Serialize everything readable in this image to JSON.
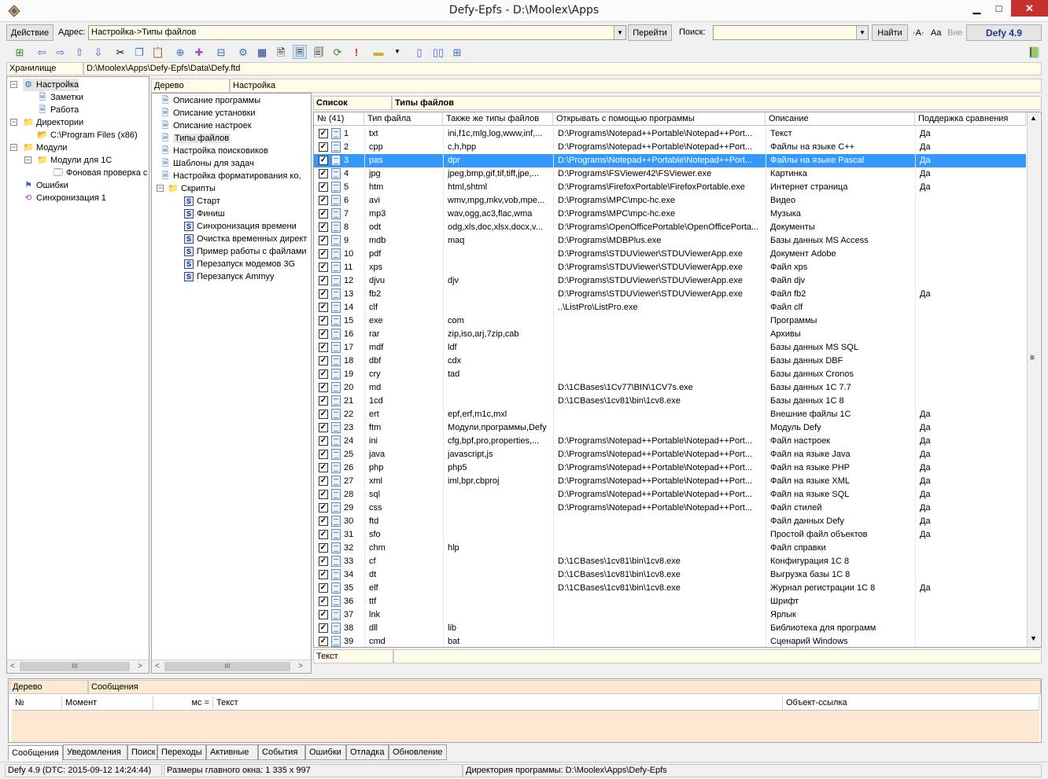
{
  "window": {
    "title": "Defy-Epfs - D:\\Moolex\\Apps",
    "min_label": "▁",
    "max_label": "□",
    "close_label": "✕"
  },
  "addressbar": {
    "action_label": "Действие",
    "address_label": "Адрес:",
    "address_value": "Настройка->Типы файлов",
    "go_label": "Перейти",
    "search_label": "Поиск:",
    "search_value": "",
    "find_label": "Найти",
    "case_label": "·A·",
    "word_label": "Aa",
    "outside_label": "Вне",
    "version_label": "Defy 4.9"
  },
  "storage": {
    "label": "Хранилище",
    "path": "D:\\Moolex\\Apps\\Defy-Epfs\\Data\\Defy.ftd"
  },
  "left_tree": {
    "items": [
      {
        "label": "Настройка",
        "icon": "settings-icon"
      },
      {
        "label": "Заметки",
        "icon": "page-icon"
      },
      {
        "label": "Работа",
        "icon": "page-icon"
      },
      {
        "label": "Директории",
        "icon": "folder-icon"
      },
      {
        "label": "C:\\Program Files (x86)",
        "icon": "folder-red-icon"
      },
      {
        "label": "Модули",
        "icon": "folder-icon"
      },
      {
        "label": "Модули для 1С",
        "icon": "folder-icon"
      },
      {
        "label": "Фоновая проверка с",
        "icon": "module-icon"
      },
      {
        "label": "Ошибки",
        "icon": "error-icon"
      },
      {
        "label": "Синхронизация 1",
        "icon": "sync-icon"
      }
    ]
  },
  "middle": {
    "header_left": "Дерево",
    "header_right": "Настройка",
    "items": [
      {
        "label": "Описание программы",
        "icon": "page-icon"
      },
      {
        "label": "Описание установки",
        "icon": "page-icon"
      },
      {
        "label": "Описание настроек",
        "icon": "page-icon"
      },
      {
        "label": "Типы файлов",
        "icon": "page-icon"
      },
      {
        "label": "Настройка поисковиков",
        "icon": "page-icon"
      },
      {
        "label": "Шаблоны для задач",
        "icon": "page-icon"
      },
      {
        "label": "Настройка форматирования ко,",
        "icon": "page-icon"
      },
      {
        "label": "Скрипты",
        "icon": "folder-icon"
      },
      {
        "label": "Старт",
        "icon": "script-icon"
      },
      {
        "label": "Финиш",
        "icon": "script-icon"
      },
      {
        "label": "Синхронизация времени",
        "icon": "script-icon"
      },
      {
        "label": "Очистка временных директ",
        "icon": "script-icon"
      },
      {
        "label": "Пример работы с файлами",
        "icon": "script-icon"
      },
      {
        "label": "Перезапуск модемов 3G",
        "icon": "script-icon"
      },
      {
        "label": "Перезапуск Ammyy",
        "icon": "script-icon"
      }
    ]
  },
  "list": {
    "header_left": "Список",
    "header_right": "Типы файлов",
    "columns": [
      "№ (41)",
      "Тип файла",
      "Также же типы файлов",
      "Открывать с помощью программы",
      "Описание",
      "Поддержка сравнения"
    ],
    "rows": [
      [
        "1",
        "txt",
        "ini,f1c,mlg,log,www,inf,...",
        "D:\\Programs\\Notepad++Portable\\Notepad++Port...",
        "Текст",
        "Да"
      ],
      [
        "2",
        "cpp",
        "c,h,hpp",
        "D:\\Programs\\Notepad++Portable\\Notepad++Port...",
        "Файлы на языке C++",
        "Да"
      ],
      [
        "3",
        "pas",
        "dpr",
        "D:\\Programs\\Notepad++Portable\\Notepad++Port...",
        "Файлы на языке Pascal",
        "Да"
      ],
      [
        "4",
        "jpg",
        "jpeg,bmp,gif,tif,tiff,jpe,...",
        "D:\\Programs\\FSViewer42\\FSViewer.exe",
        "Картинка",
        "Да"
      ],
      [
        "5",
        "htm",
        "html,shtml",
        "D:\\Programs\\FirefoxPortable\\FirefoxPortable.exe",
        "Интернет страница",
        "Да"
      ],
      [
        "6",
        "avi",
        "wmv,mpg,mkv,vob,mpe...",
        "D:\\Programs\\MPC\\mpc-hc.exe",
        "Видео",
        ""
      ],
      [
        "7",
        "mp3",
        "wav,ogg,ac3,flac,wma",
        "D:\\Programs\\MPC\\mpc-hc.exe",
        "Музыка",
        ""
      ],
      [
        "8",
        "odt",
        "odg,xls,doc,xlsx,docx,v...",
        "D:\\Programs\\OpenOfficePortable\\OpenOfficePorta...",
        "Документы",
        ""
      ],
      [
        "9",
        "mdb",
        "maq",
        "D:\\Programs\\MDBPlus.exe",
        "Базы данных MS Access",
        ""
      ],
      [
        "10",
        "pdf",
        "",
        "D:\\Programs\\STDUViewer\\STDUViewerApp.exe",
        "Документ Adobe",
        ""
      ],
      [
        "11",
        "xps",
        "",
        "D:\\Programs\\STDUViewer\\STDUViewerApp.exe",
        "Файл xps",
        ""
      ],
      [
        "12",
        "djvu",
        "djv",
        "D:\\Programs\\STDUViewer\\STDUViewerApp.exe",
        "Файл djv",
        ""
      ],
      [
        "13",
        "fb2",
        "",
        "D:\\Programs\\STDUViewer\\STDUViewerApp.exe",
        "Файл fb2",
        "Да"
      ],
      [
        "14",
        "clf",
        "",
        "..\\ListPro\\ListPro.exe",
        "Файл clf",
        ""
      ],
      [
        "15",
        "exe",
        "com",
        "",
        "Программы",
        ""
      ],
      [
        "16",
        "rar",
        "zip,iso,arj,7zip,cab",
        "",
        "Архивы",
        ""
      ],
      [
        "17",
        "mdf",
        "ldf",
        "",
        "Базы данных MS SQL",
        ""
      ],
      [
        "18",
        "dbf",
        "cdx",
        "",
        "Базы данных DBF",
        ""
      ],
      [
        "19",
        "cry",
        "tad",
        "",
        "Базы данных Cronos",
        ""
      ],
      [
        "20",
        "md",
        "",
        "D:\\1CBases\\1Cv77\\BIN\\1CV7s.exe",
        "Базы данных 1С 7.7",
        ""
      ],
      [
        "21",
        "1cd",
        "",
        "D:\\1CBases\\1cv81\\bin\\1cv8.exe",
        "Базы данных 1С 8",
        ""
      ],
      [
        "22",
        "ert",
        "epf,erf,m1c,mxl",
        "",
        "Внешние файлы 1С",
        "Да"
      ],
      [
        "23",
        "ftm",
        "Модули,программы,Defy",
        "",
        "Модуль Defy",
        "Да"
      ],
      [
        "24",
        "ini",
        "cfg,bpf,pro,properties,...",
        "D:\\Programs\\Notepad++Portable\\Notepad++Port...",
        "Файл настроек",
        "Да"
      ],
      [
        "25",
        "java",
        "javascript,js",
        "D:\\Programs\\Notepad++Portable\\Notepad++Port...",
        "Файл на языке Java",
        "Да"
      ],
      [
        "26",
        "php",
        "php5",
        "D:\\Programs\\Notepad++Portable\\Notepad++Port...",
        "Файл на языке PHP",
        "Да"
      ],
      [
        "27",
        "xml",
        "iml,bpr,cbproj",
        "D:\\Programs\\Notepad++Portable\\Notepad++Port...",
        "Файл на языке XML",
        "Да"
      ],
      [
        "28",
        "sql",
        "",
        "D:\\Programs\\Notepad++Portable\\Notepad++Port...",
        "Файл на языке SQL",
        "Да"
      ],
      [
        "29",
        "css",
        "",
        "D:\\Programs\\Notepad++Portable\\Notepad++Port...",
        "Файл стилей",
        "Да"
      ],
      [
        "30",
        "ftd",
        "",
        "",
        "Файл данных Defy",
        "Да"
      ],
      [
        "31",
        "sfo",
        "",
        "",
        "Простой файл объектов",
        "Да"
      ],
      [
        "32",
        "chm",
        "hlp",
        "",
        "Файл справки",
        ""
      ],
      [
        "33",
        "cf",
        "",
        "D:\\1CBases\\1cv81\\bin\\1cv8.exe",
        "Конфигурация 1С 8",
        ""
      ],
      [
        "34",
        "dt",
        "",
        "D:\\1CBases\\1cv81\\bin\\1cv8.exe",
        "Выгрузка базы 1С 8",
        ""
      ],
      [
        "35",
        "elf",
        "",
        "D:\\1CBases\\1cv81\\bin\\1cv8.exe",
        "Журнал регистрации 1С 8",
        "Да"
      ],
      [
        "36",
        "ttf",
        "",
        "",
        "Шрифт",
        ""
      ],
      [
        "37",
        "lnk",
        "",
        "",
        "Ярлык",
        ""
      ],
      [
        "38",
        "dll",
        "lib",
        "",
        "Библиотека для программ",
        ""
      ],
      [
        "39",
        "cmd",
        "bat",
        "",
        "Сценарий Windows",
        ""
      ]
    ],
    "selected_row": 2,
    "text_label": "Текст"
  },
  "messages": {
    "header_left": "Дерево",
    "header_right": "Сообщения",
    "columns": [
      "№",
      "Момент",
      "мс =",
      "Текст",
      "Объект-ссылка"
    ]
  },
  "tabs": [
    "Сообщения",
    "Уведомления",
    "Поиск",
    "Переходы",
    "Активные",
    "События",
    "Ошибки",
    "Отладка",
    "Обновление"
  ],
  "status": {
    "version": "Defy 4.9 (DTC: 2015-09-12 14:24:44)",
    "window_size": "Размеры главного окна: 1 335 x 997",
    "program_dir": "Директория программы: D:\\Moolex\\Apps\\Defy-Epfs"
  },
  "colors": {
    "selection": "#3399ff",
    "field_bg": "#fffbe8",
    "message_bg": "#fde8d2",
    "close_button": "#c7302b"
  }
}
